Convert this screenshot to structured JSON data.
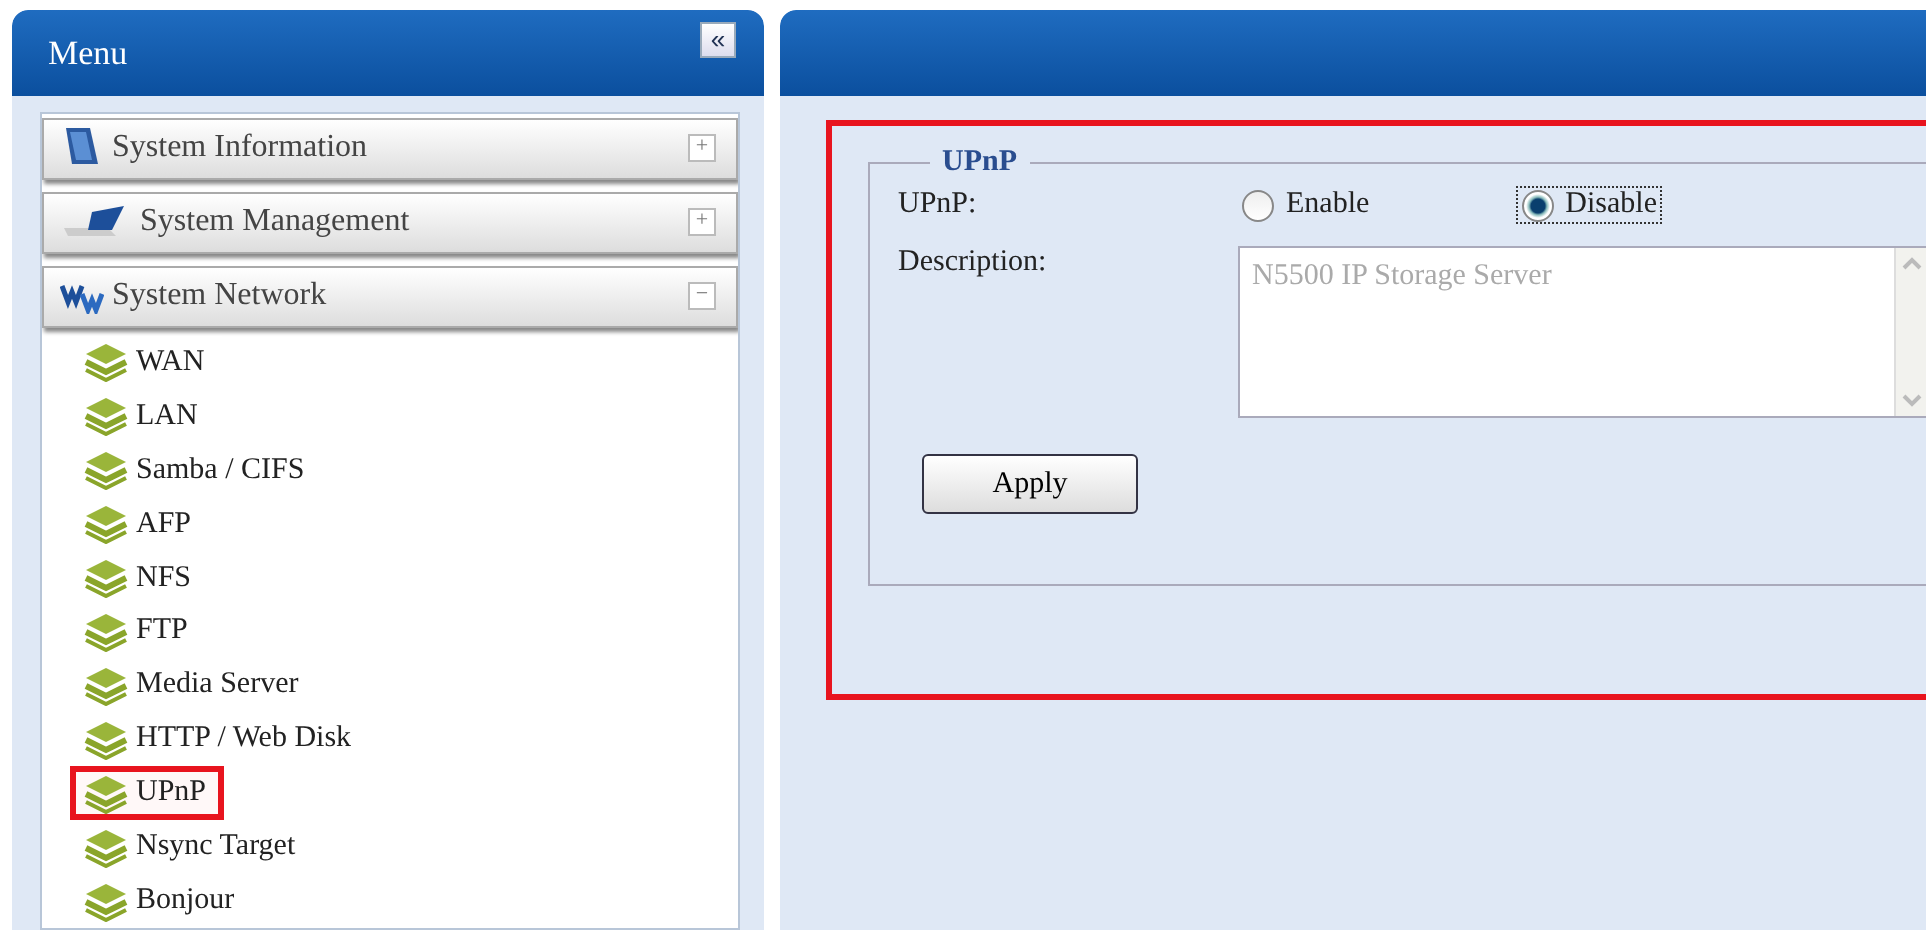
{
  "menu": {
    "title": "Menu",
    "collapse_glyph": "«",
    "groups": [
      {
        "label": "System Information",
        "kind": "info",
        "expanded": false,
        "glyph": "+"
      },
      {
        "label": "System Management",
        "kind": "management",
        "expanded": false,
        "glyph": "+"
      },
      {
        "label": "System Network",
        "kind": "network",
        "expanded": true,
        "glyph": "−",
        "children": [
          {
            "label": "WAN",
            "highlighted": false
          },
          {
            "label": "LAN",
            "highlighted": false
          },
          {
            "label": "Samba / CIFS",
            "highlighted": false
          },
          {
            "label": "AFP",
            "highlighted": false
          },
          {
            "label": "NFS",
            "highlighted": false
          },
          {
            "label": "FTP",
            "highlighted": false
          },
          {
            "label": "Media Server",
            "highlighted": false
          },
          {
            "label": "HTTP / Web Disk",
            "highlighted": false
          },
          {
            "label": "UPnP",
            "highlighted": true
          },
          {
            "label": "Nsync Target",
            "highlighted": false
          },
          {
            "label": "Bonjour",
            "highlighted": false
          }
        ]
      }
    ]
  },
  "content": {
    "highlighted": true,
    "section": {
      "legend": "UPnP",
      "upnp_label": "UPnP:",
      "options": [
        {
          "label": "Enable",
          "selected": false
        },
        {
          "label": "Disable",
          "selected": true
        }
      ],
      "description_label": "Description:",
      "description_value": "N5500 IP Storage Server",
      "apply": "Apply"
    }
  }
}
